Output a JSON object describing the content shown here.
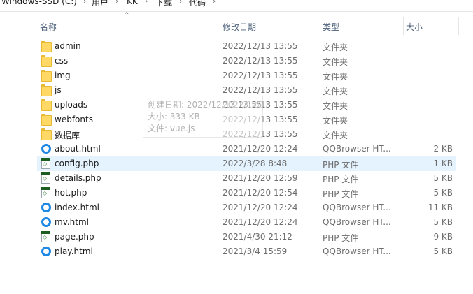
{
  "breadcrumb": {
    "items": [
      "Windows-SSD (C:)",
      "用户",
      "KK",
      "下载",
      "代码"
    ]
  },
  "columns": {
    "name": "名称",
    "date": "修改日期",
    "type": "类型",
    "size": "大小"
  },
  "files": [
    {
      "name": "admin",
      "date": "2022/12/13 13:55",
      "type": "文件夹",
      "size": "",
      "icon": "folder-icon"
    },
    {
      "name": "css",
      "date": "2022/12/13 13:55",
      "type": "文件夹",
      "size": "",
      "icon": "folder-icon"
    },
    {
      "name": "img",
      "date": "2022/12/13 13:55",
      "type": "文件夹",
      "size": "",
      "icon": "folder-icon"
    },
    {
      "name": "js",
      "date": "2022/12/13 13:55",
      "type": "文件夹",
      "size": "",
      "icon": "folder-icon"
    },
    {
      "name": "uploads",
      "date": "2022/12/13 13:55",
      "type": "文件夹",
      "size": "",
      "icon": "folder-icon"
    },
    {
      "name": "webfonts",
      "date": "2022/12/13 13:55",
      "type": "文件夹",
      "size": "",
      "icon": "folder-icon"
    },
    {
      "name": "数据库",
      "date": "2022/12/13 13:55",
      "type": "文件夹",
      "size": "",
      "icon": "folder-icon"
    },
    {
      "name": "about.html",
      "date": "2021/12/20 12:24",
      "type": "QQBrowser HT...",
      "size": "2 KB",
      "icon": "qqbrowser-html-icon"
    },
    {
      "name": "config.php",
      "date": "2022/3/28 8:48",
      "type": "PHP 文件",
      "size": "1 KB",
      "icon": "php-file-icon"
    },
    {
      "name": "details.php",
      "date": "2021/12/20 12:59",
      "type": "PHP 文件",
      "size": "5 KB",
      "icon": "php-file-icon"
    },
    {
      "name": "hot.php",
      "date": "2021/12/20 12:54",
      "type": "PHP 文件",
      "size": "5 KB",
      "icon": "php-file-icon"
    },
    {
      "name": "index.html",
      "date": "2021/12/20 12:24",
      "type": "QQBrowser HT...",
      "size": "11 KB",
      "icon": "qqbrowser-html-icon"
    },
    {
      "name": "mv.html",
      "date": "2021/12/20 12:24",
      "type": "QQBrowser HT...",
      "size": "5 KB",
      "icon": "qqbrowser-html-icon"
    },
    {
      "name": "page.php",
      "date": "2021/4/30 21:12",
      "type": "PHP 文件",
      "size": "9 KB",
      "icon": "php-file-icon"
    },
    {
      "name": "play.html",
      "date": "2021/3/4 15:59",
      "type": "QQBrowser HT...",
      "size": "5 KB",
      "icon": "qqbrowser-html-icon"
    }
  ],
  "selected_file": "config.php",
  "tooltip": {
    "line1": "创建日期: 2022/12/13 13:55",
    "line2": "大小: 333 KB",
    "line3": "文件: vue.js"
  }
}
